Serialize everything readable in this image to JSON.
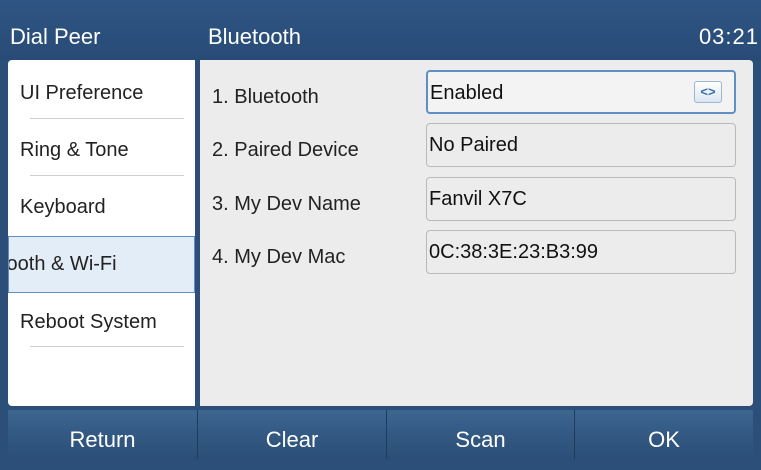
{
  "header": {
    "left_title": "Dial Peer",
    "title": "Bluetooth",
    "time": "03:21"
  },
  "sidebar": {
    "items": [
      {
        "label": "UI Preference"
      },
      {
        "label": "Ring & Tone"
      },
      {
        "label": "Keyboard"
      },
      {
        "label": "tooth & Wi-Fi",
        "selected": true
      },
      {
        "label": "Reboot System"
      }
    ]
  },
  "settings": {
    "rows": [
      {
        "label": "1. Bluetooth",
        "value": "Enabled",
        "control": "selector",
        "control_icon": "left-right-arrows-icon"
      },
      {
        "label": "2. Paired Device",
        "value": "No Paired"
      },
      {
        "label": "3. My Dev Name",
        "value": "Fanvil X7C"
      },
      {
        "label": "4. My Dev Mac",
        "value": "0C:38:3E:23:B3:99"
      }
    ],
    "toggle_glyph": "<>"
  },
  "softkeys": [
    {
      "label": "Return"
    },
    {
      "label": "Clear"
    },
    {
      "label": "Scan"
    },
    {
      "label": "OK"
    }
  ],
  "colors": {
    "header_bg": "#2c4f79",
    "softkey_bg": "#2f5582",
    "selection_border": "#5f8fc3",
    "panel_bg": "#ececec"
  }
}
